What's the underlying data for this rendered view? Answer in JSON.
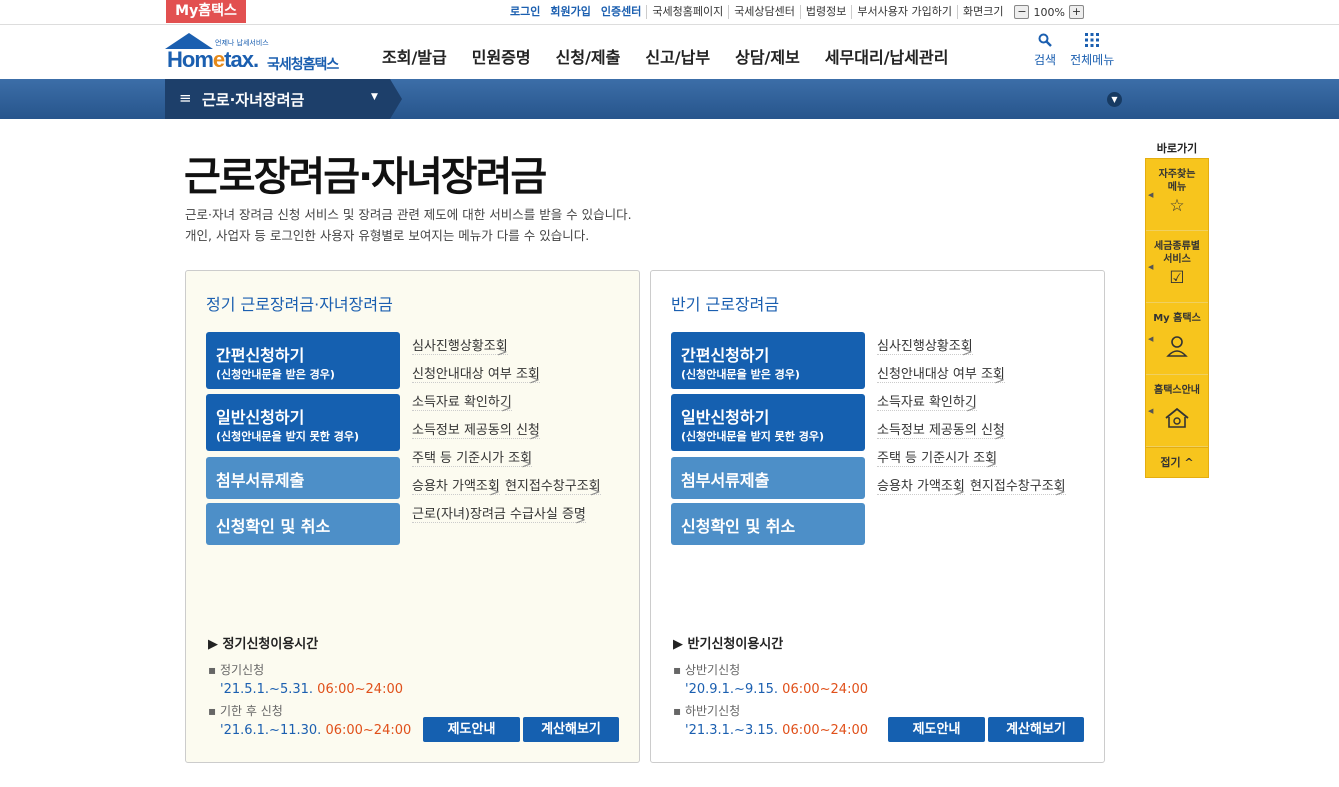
{
  "topbar": {
    "my_hometax": "My홈택스",
    "links": [
      "로그인",
      "회원가입",
      "인증센터",
      "국세청홈페이지",
      "국세상담센터",
      "법령정보",
      "부서사용자 가입하기",
      "화면크기"
    ],
    "zoom_minus": "−",
    "zoom_value": "100%",
    "zoom_plus": "+"
  },
  "header": {
    "logo_small": "언제나 납세서비스",
    "logo_word_a": "Hom",
    "logo_word_e": "e",
    "logo_word_b": "tax.",
    "logo_kor": "국세청홈택스",
    "gnb": [
      "조회/발급",
      "민원증명",
      "신청/제출",
      "신고/납부",
      "상담/제보",
      "세무대리/납세관리"
    ],
    "search_label": "검색",
    "allmenu_label": "전체메뉴"
  },
  "band": {
    "current_menu": "근로·자녀장려금"
  },
  "page": {
    "title": "근로장려금·자녀장려금",
    "desc1": "근로·자녀 장려금 신청 서비스 및 장려금 관련 제도에 대한 서비스를 받을 수 있습니다.",
    "desc2": "개인, 사업자 등 로그인한 사용자 유형별로 보여지는 메뉴가 다를 수 있습니다."
  },
  "panel1": {
    "title": "정기 근로장려금·자녀장려금",
    "buttons": [
      {
        "l1": "간편신청하기",
        "l2": "(신청안내문을 받은 경우)"
      },
      {
        "l1": "일반신청하기",
        "l2": "(신청안내문을 받지 못한 경우)"
      },
      {
        "l1": "첨부서류제출"
      },
      {
        "l1": "신청확인 및 취소"
      }
    ],
    "list": [
      "심사진행상황조회",
      "신청안내대상 여부 조회",
      "소득자료 확인하기",
      "소득정보 제공동의 신청",
      "주택 등 기준시가 조회",
      "승용차 가액조회",
      "현지접수창구조회",
      "근로(자녀)장려금 수급사실 증명"
    ],
    "time_heading": "▶ 정기신청이용시간",
    "times": [
      {
        "label": "정기신청",
        "date": "'21.5.1.~5.31.",
        "hours": "06:00~24:00"
      },
      {
        "label": "기한 후 신청",
        "date": "'21.6.1.~11.30.",
        "hours": "06:00~24:00"
      }
    ],
    "btn_info": "제도안내",
    "btn_calc": "계산해보기"
  },
  "panel2": {
    "title": "반기 근로장려금",
    "buttons": [
      {
        "l1": "간편신청하기",
        "l2": "(신청안내문을 받은 경우)"
      },
      {
        "l1": "일반신청하기",
        "l2": "(신청안내문을 받지 못한 경우)"
      },
      {
        "l1": "첨부서류제출"
      },
      {
        "l1": "신청확인 및 취소"
      }
    ],
    "list": [
      "심사진행상황조회",
      "신청안내대상 여부 조회",
      "소득자료 확인하기",
      "소득정보 제공동의 신청",
      "주택 등 기준시가 조회",
      "승용차 가액조회",
      "현지접수창구조회"
    ],
    "time_heading": "▶ 반기신청이용시간",
    "times": [
      {
        "label": "상반기신청",
        "date": "'20.9.1.~9.15.",
        "hours": "06:00~24:00"
      },
      {
        "label": "하반기신청",
        "date": "'21.3.1.~3.15.",
        "hours": "06:00~24:00"
      }
    ],
    "btn_info": "제도안내",
    "btn_calc": "계산해보기"
  },
  "quick": {
    "heading": "바로가기",
    "items": [
      {
        "label1": "자주찾는",
        "label2": "메뉴",
        "icon": "star-icon"
      },
      {
        "label1": "세금종류별",
        "label2": "서비스",
        "icon": "checkbox-icon"
      },
      {
        "label1": "My 홈택스",
        "label2": "",
        "icon": "user-icon"
      },
      {
        "label1": "홈택스안내",
        "label2": "",
        "icon": "house-icon"
      }
    ],
    "close": "접기 ^"
  },
  "colors": {
    "brand_blue": "#1560b0",
    "light_blue": "#4d8fc8",
    "accent_red": "#e25050",
    "time_red": "#e0501a",
    "quick_yellow": "#f7c51d",
    "panel_bg": "#fcfbf0"
  }
}
